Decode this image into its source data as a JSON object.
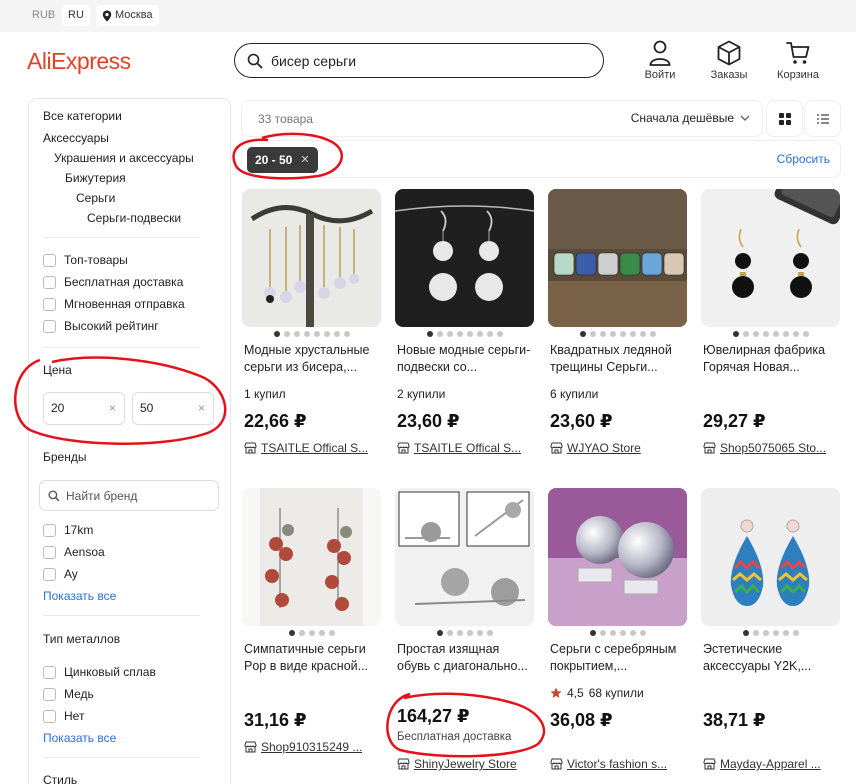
{
  "topbar": {
    "currency": "RUB",
    "language": "RU",
    "location": "Москва"
  },
  "header": {
    "logo": "AliExpress",
    "search_value": "бисер серьги",
    "login_label": "Войти",
    "orders_label": "Заказы",
    "cart_label": "Корзина"
  },
  "sidebar": {
    "categories": [
      "Все категории",
      "Аксессуары",
      "Украшения и аксессуары",
      "Бижутерия",
      "Серьги",
      "Серьги-подвески"
    ],
    "quick_filters": [
      "Топ-товары",
      "Бесплатная доставка",
      "Мгновенная отправка",
      "Высокий рейтинг"
    ],
    "price_title": "Цена",
    "price_min": "20",
    "price_max": "50",
    "brands_title": "Бренды",
    "brand_search_placeholder": "Найти бренд",
    "brands": [
      "17km",
      "Aensoa",
      "Ay"
    ],
    "show_all": "Показать все",
    "metal_title": "Тип металлов",
    "metals": [
      "Цинковый сплав",
      "Медь",
      "Нет"
    ],
    "style_title": "Стиль"
  },
  "results": {
    "count": "33 товара",
    "sort": "Сначала дешёвые",
    "active_filter": "20 - 50",
    "reset": "Сбросить"
  },
  "products": [
    {
      "title": "Модные хрустальные серьги из бисера,...",
      "sold": "1 купил",
      "price": "22,66 ₽",
      "store": "TSAITLE Offical S..."
    },
    {
      "title": "Новые модные серьги-подвески со...",
      "sold": "2 купили",
      "price": "23,60 ₽",
      "store": "TSAITLE Offical S..."
    },
    {
      "title": "Квадратных ледяной трещины Серьги...",
      "sold": "6 купили",
      "price": "23,60 ₽",
      "store": "WJYAO Store"
    },
    {
      "title": "Ювелирная фабрика Горячая Новая...",
      "sold": "",
      "price": "29,27 ₽",
      "store": "Shop5075065 Sto..."
    },
    {
      "title": "Симпатичные серьги Pop в виде красной...",
      "sold": "",
      "price": "31,16 ₽",
      "store": "Shop910315249 ..."
    },
    {
      "title": "Простая изящная обувь с диагонально...",
      "sold": "",
      "price": "164,27 ₽",
      "shipping": "Бесплатная доставка",
      "store": "ShinyJewelry Store"
    },
    {
      "title": "Серьги с серебряным покрытием,...",
      "rating": "4,5",
      "sold": "68 купили",
      "price": "36,08 ₽",
      "store": "Victor's fashion s..."
    },
    {
      "title": "Эстетические аксессуары Y2K,...",
      "sold": "",
      "price": "38,71 ₽",
      "store": "Mayday-Apparel ..."
    }
  ],
  "colors": {
    "brand": "#e2402a",
    "link": "#2f6ed6",
    "annotation": "#e3121a",
    "star": "#c9462b"
  }
}
